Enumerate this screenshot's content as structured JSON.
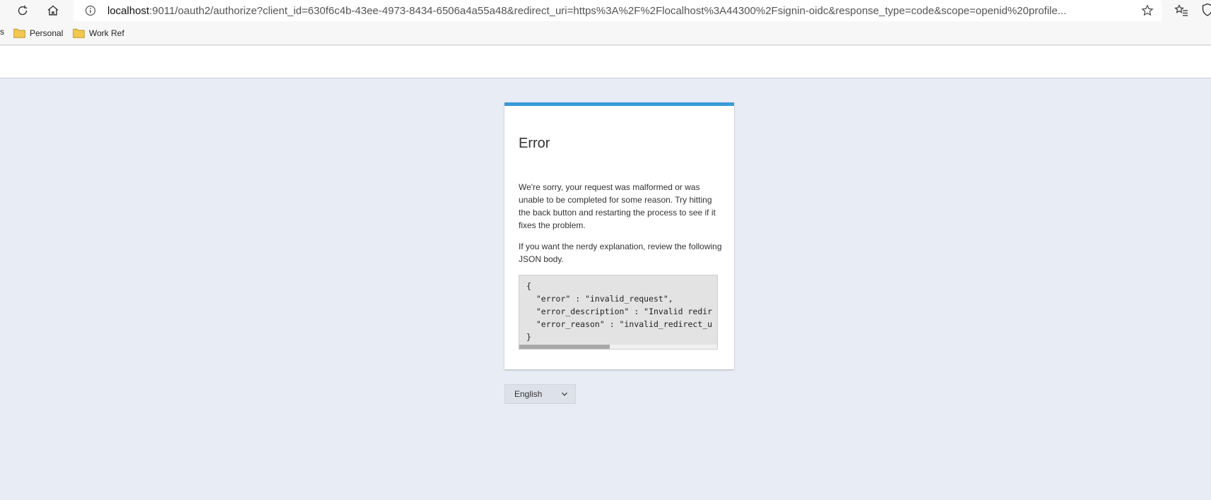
{
  "browser": {
    "url_host": "localhost",
    "url_rest": ":9011/oauth2/authorize?client_id=630f6c4b-43ee-4973-8434-6506a4a55a48&redirect_uri=https%3A%2F%2Flocalhost%3A44300%2Fsignin-oidc&response_type=code&scope=openid%20profile...",
    "bookmarks": [
      {
        "label": "Personal"
      },
      {
        "label": "Work Ref"
      }
    ],
    "bookmark_cut": "s"
  },
  "card": {
    "title": "Error",
    "message": "We're sorry, your request was malformed or was unable to be completed for some reason. Try hitting the back button and restarting the process to see if it fixes the problem.",
    "nerdy": "If you want the nerdy explanation, review the following JSON body.",
    "json_lines": [
      "{",
      "  \"error\" : \"invalid_request\",",
      "  \"error_description\" : \"Invalid redir",
      "  \"error_reason\" : \"invalid_redirect_u",
      "}"
    ]
  },
  "language": {
    "selected": "English"
  },
  "colors": {
    "accent": "#3a9ad9",
    "page_bg": "#e8ecf4"
  }
}
